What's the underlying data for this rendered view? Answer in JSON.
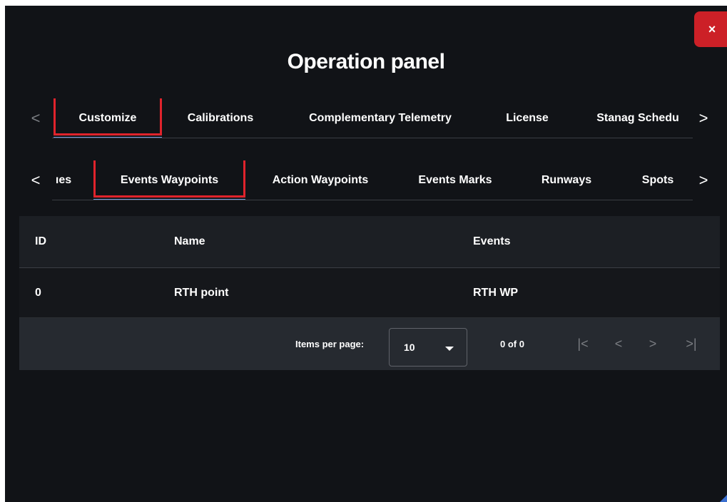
{
  "dialog": {
    "title": "Operation panel",
    "close_icon": "close-icon",
    "close_label": "×"
  },
  "primary_tabs": {
    "prev_label": "<",
    "next_label": ">",
    "items": [
      {
        "label": "Customize",
        "active": true,
        "highlighted": true
      },
      {
        "label": "Calibrations"
      },
      {
        "label": "Complementary Telemetry"
      },
      {
        "label": "License"
      },
      {
        "label": "Stanag Schedu"
      }
    ]
  },
  "secondary_tabs": {
    "prev_label": "<",
    "next_label": ">",
    "items": [
      {
        "label": "ıes"
      },
      {
        "label": "Events Waypoints",
        "active": true,
        "highlighted": true
      },
      {
        "label": "Action Waypoints"
      },
      {
        "label": "Events Marks"
      },
      {
        "label": "Runways"
      },
      {
        "label": "Spots"
      }
    ]
  },
  "table": {
    "columns": [
      "ID",
      "Name",
      "Events"
    ],
    "rows": [
      {
        "id": "0",
        "name": "RTH point",
        "events": "RTH WP"
      }
    ]
  },
  "paginator": {
    "items_per_page_label": "Items per page:",
    "page_size": "10",
    "range_label": "0 of 0",
    "first_label": "|<",
    "prev_label": "<",
    "next_label": ">",
    "last_label": ">|"
  },
  "colors": {
    "background": "#111317",
    "accent_underline": "#7b9ee0",
    "highlight_box": "#e0232c",
    "close_button": "#cc2027"
  }
}
